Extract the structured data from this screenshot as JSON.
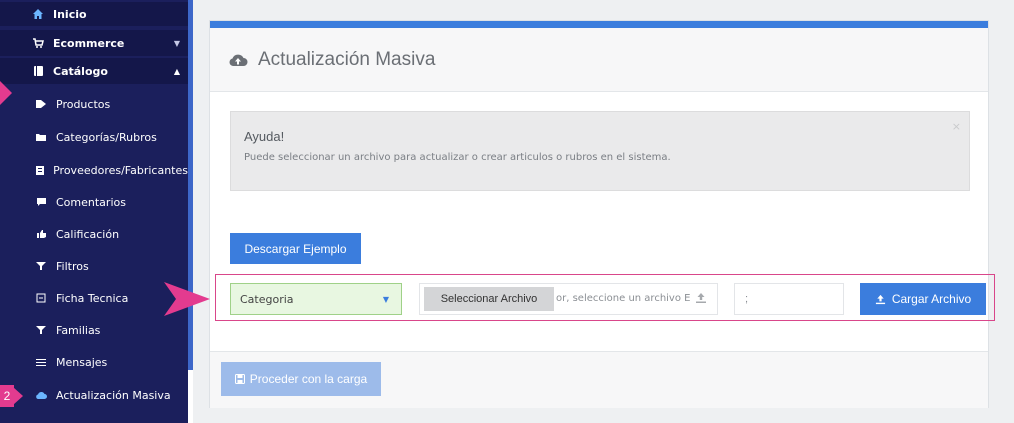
{
  "sidebar": {
    "items": [
      {
        "label": "Inicio",
        "icon": "home-icon"
      },
      {
        "label": "Ecommerce",
        "icon": "cart-icon"
      },
      {
        "label": "Catálogo",
        "icon": "book-icon"
      },
      {
        "label": "Productos",
        "icon": "tags-icon"
      },
      {
        "label": "Categorías/Rubros",
        "icon": "folder-icon"
      },
      {
        "label": "Proveedores/Fabricantes",
        "icon": "building-icon"
      },
      {
        "label": "Comentarios",
        "icon": "comment-icon"
      },
      {
        "label": "Calificación",
        "icon": "thumbs-up-icon"
      },
      {
        "label": "Filtros",
        "icon": "filter-icon"
      },
      {
        "label": "Ficha Tecnica",
        "icon": "list-box-icon"
      },
      {
        "label": "Familias",
        "icon": "filter-icon"
      },
      {
        "label": "Mensajes",
        "icon": "menu-lines-icon"
      },
      {
        "label": "Actualización Masiva",
        "icon": "cloud-upload-icon"
      }
    ],
    "step_badge": "2"
  },
  "card": {
    "title": "Actualización Masiva",
    "help_title": "Ayuda!",
    "help_text": "Puede seleccionar un archivo para actualizar o crear articulos o rubros en el sistema.",
    "help_close": "×",
    "download_label": "Descargar Ejemplo",
    "select_value": "Categoria",
    "file_button_label": "Seleccionar Archivo",
    "file_placeholder": "or, seleccione un archivo E",
    "separator_value": ";",
    "upload_label": "Cargar Archivo",
    "proceed_label": "Proceder con la carga"
  },
  "colors": {
    "sidebar_bg": "#1b1f5c",
    "accent_blue": "#3b7ddd",
    "highlight_pink": "#e33b8f",
    "select_green_bg": "#e8f7e1"
  }
}
